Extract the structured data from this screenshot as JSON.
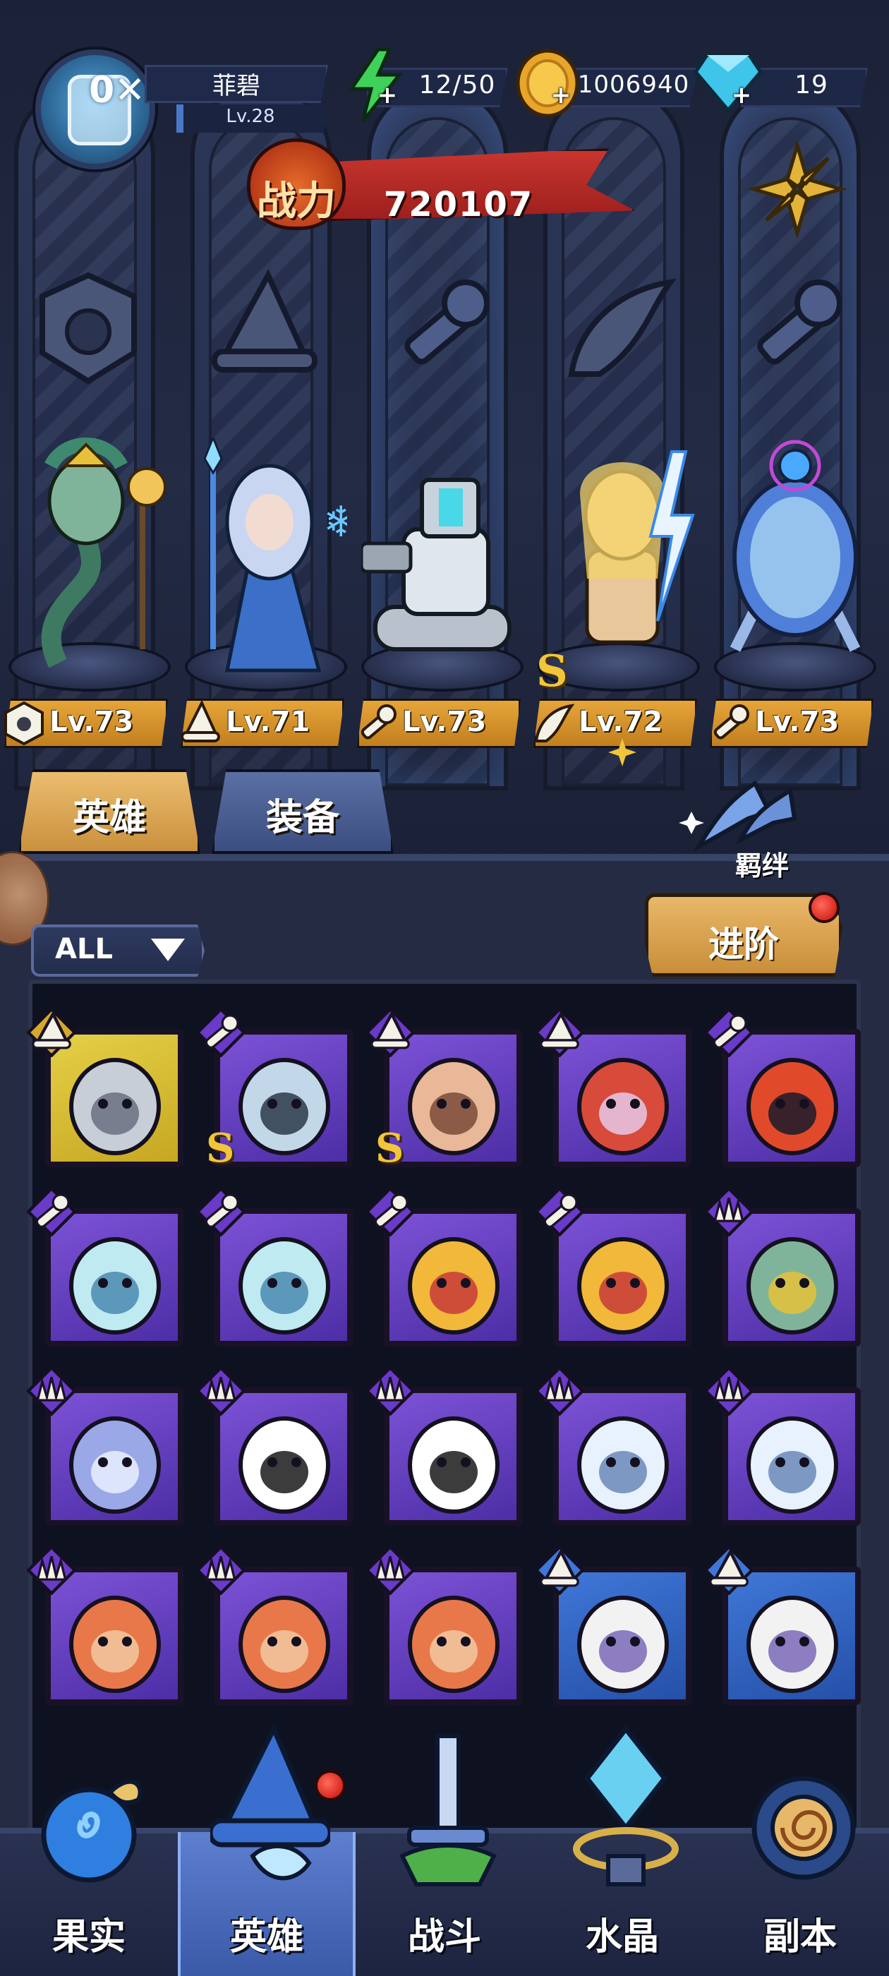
{
  "player": {
    "name": "菲碧",
    "level": "Lv.28",
    "avatar_badge": "0"
  },
  "resources": {
    "energy": "12/50",
    "gold": "1006940",
    "gems": "19"
  },
  "power": {
    "label": "战力",
    "value": "720107"
  },
  "team": [
    {
      "class_icon": "claw-class-icon",
      "level": "Lv.73",
      "rank": ""
    },
    {
      "class_icon": "mage-hat-class-icon",
      "level": "Lv.71",
      "rank": ""
    },
    {
      "class_icon": "wrench-class-icon",
      "level": "Lv.73",
      "rank": ""
    },
    {
      "class_icon": "wing-class-icon",
      "level": "Lv.72",
      "rank": "S"
    },
    {
      "class_icon": "wrench-class-icon",
      "level": "Lv.73",
      "rank": ""
    }
  ],
  "tabs": {
    "heroes": "英雄",
    "equipment": "装备",
    "bond": "羁绊"
  },
  "filter": {
    "label": "ALL"
  },
  "advance": {
    "label": "进阶"
  },
  "roster": [
    {
      "frame": "gold",
      "class_icon": "mage-hat-class-icon",
      "portrait": "knight-helmet-portrait",
      "rank": ""
    },
    {
      "frame": "purple",
      "class_icon": "wrench-class-icon",
      "portrait": "robot-gunner-portrait",
      "rank": "S"
    },
    {
      "frame": "purple",
      "class_icon": "mage-hat-class-icon",
      "portrait": "bald-warrior-portrait",
      "rank": "S"
    },
    {
      "frame": "purple",
      "class_icon": "mage-hat-class-icon",
      "portrait": "red-hood-mage-portrait",
      "rank": ""
    },
    {
      "frame": "purple",
      "class_icon": "wrench-class-icon",
      "portrait": "diving-robot-portrait",
      "rank": ""
    },
    {
      "frame": "purple",
      "class_icon": "wrench-class-icon",
      "portrait": "capsule-pod-portrait",
      "rank": ""
    },
    {
      "frame": "purple",
      "class_icon": "wrench-class-icon",
      "portrait": "capsule-pod-portrait",
      "rank": ""
    },
    {
      "frame": "purple",
      "class_icon": "wrench-class-icon",
      "portrait": "golden-mech-portrait",
      "rank": ""
    },
    {
      "frame": "purple",
      "class_icon": "wrench-class-icon",
      "portrait": "golden-mech-portrait",
      "rank": ""
    },
    {
      "frame": "purple",
      "class_icon": "claw-class-icon",
      "portrait": "medusa-portrait",
      "rank": ""
    },
    {
      "frame": "purple",
      "class_icon": "claw-class-icon",
      "portrait": "wolf-portrait",
      "rank": ""
    },
    {
      "frame": "purple",
      "class_icon": "claw-class-icon",
      "portrait": "panda-portrait",
      "rank": ""
    },
    {
      "frame": "purple",
      "class_icon": "claw-class-icon",
      "portrait": "panda-portrait",
      "rank": ""
    },
    {
      "frame": "purple",
      "class_icon": "claw-class-icon",
      "portrait": "white-tiger-portrait",
      "rank": ""
    },
    {
      "frame": "purple",
      "class_icon": "claw-class-icon",
      "portrait": "white-tiger-portrait",
      "rank": ""
    },
    {
      "frame": "purple",
      "class_icon": "claw-class-icon",
      "portrait": "fox-portrait",
      "rank": ""
    },
    {
      "frame": "purple",
      "class_icon": "claw-class-icon",
      "portrait": "fox-portrait",
      "rank": ""
    },
    {
      "frame": "purple",
      "class_icon": "claw-class-icon",
      "portrait": "fox-portrait",
      "rank": ""
    },
    {
      "frame": "blue",
      "class_icon": "mage-hat-class-icon",
      "portrait": "bandaged-nun-portrait",
      "rank": ""
    },
    {
      "frame": "blue",
      "class_icon": "mage-hat-class-icon",
      "portrait": "bandaged-nun-portrait",
      "rank": ""
    }
  ],
  "nav": [
    {
      "label": "果实",
      "icon": "fruit-icon"
    },
    {
      "label": "英雄",
      "icon": "wizard-hat-icon"
    },
    {
      "label": "战斗",
      "icon": "sword-icon"
    },
    {
      "label": "水晶",
      "icon": "crystal-icon"
    },
    {
      "label": "副本",
      "icon": "portal-icon"
    }
  ],
  "colors": {
    "gold_accent": "#e6a53a",
    "power_red": "#c8352e",
    "epic_purple": "#7c52d6",
    "rare_blue": "#3f77d8",
    "legend_gold": "#e4d046"
  }
}
